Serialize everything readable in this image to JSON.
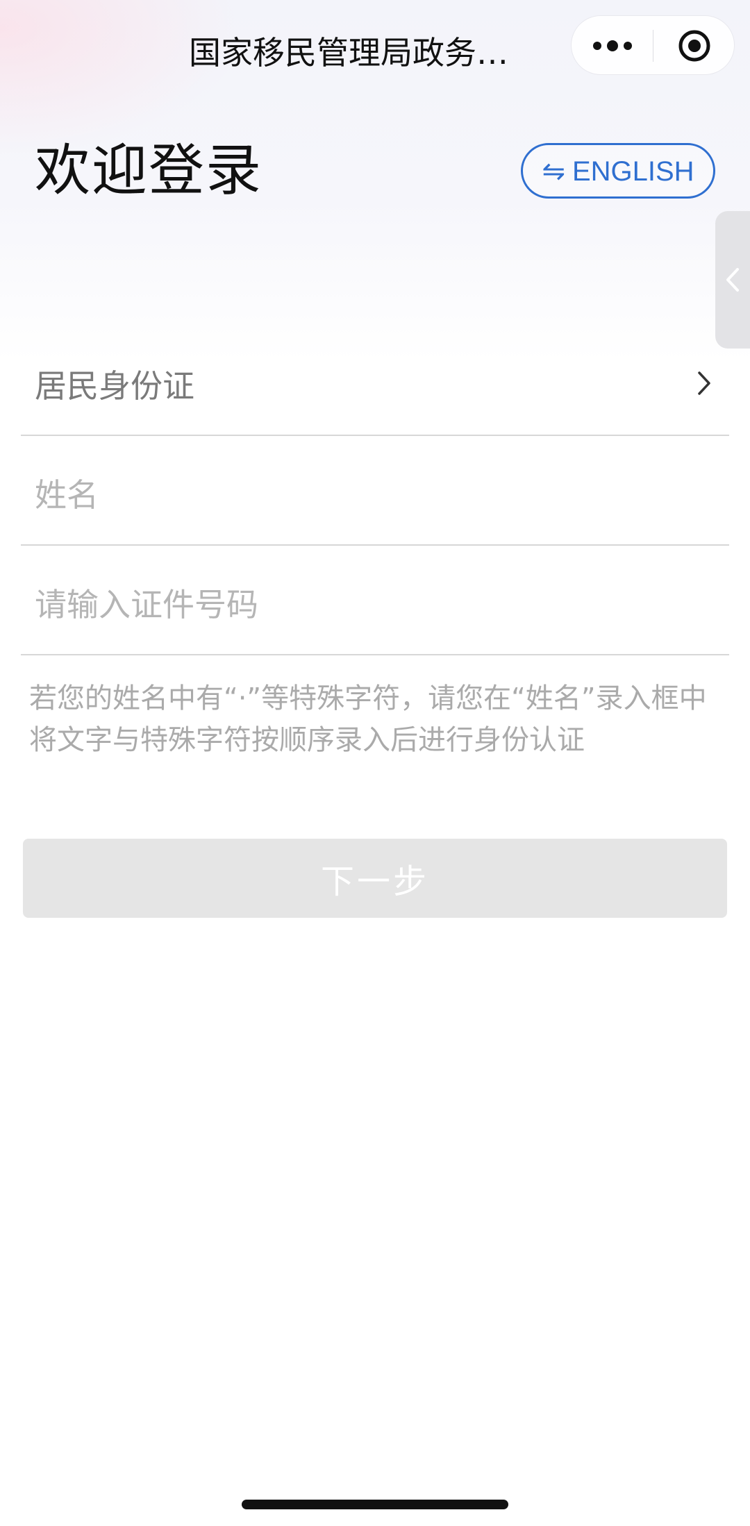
{
  "navbar": {
    "title": "国家移民管理局政务…",
    "more_icon": "more-dots-icon",
    "record_icon": "record-target-icon"
  },
  "header": {
    "title": "欢迎登录",
    "language_button_icon": "⇋",
    "language_button_label": "ENGLISH"
  },
  "side_tab": {
    "icon": "chevron-left-icon"
  },
  "form": {
    "id_type": {
      "value": "居民身份证",
      "icon": "chevron-right-icon"
    },
    "name": {
      "placeholder": "姓名",
      "value": ""
    },
    "id_number": {
      "placeholder": "请输入证件号码",
      "value": ""
    },
    "hint": "若您的姓名中有“·”等特殊字符，请您在“姓名”录入框中将文字与特殊字符按顺序录入后进行身份认证",
    "next_label": "下一步"
  },
  "colors": {
    "accent": "#2f6fd0",
    "button_disabled_bg": "#e5e5e5",
    "placeholder": "#b5b5b5",
    "hint": "#aaaaaa"
  }
}
